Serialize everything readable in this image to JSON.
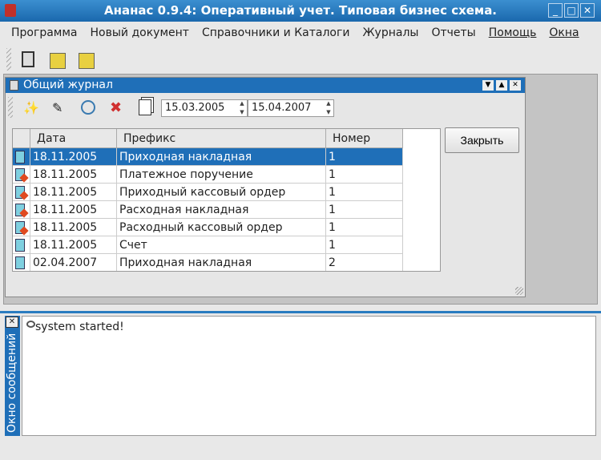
{
  "window": {
    "title": "Ананас 0.9.4: Оперативный учет. Типовая бизнес схема.",
    "minimize": "_",
    "maximize": "□",
    "close": "✕"
  },
  "menu": [
    {
      "label": "Программа"
    },
    {
      "label": "Новый документ"
    },
    {
      "label": "Справочники и Каталоги"
    },
    {
      "label": "Журналы"
    },
    {
      "label": "Отчеты"
    },
    {
      "label": "Помощь",
      "underline": true
    },
    {
      "label": "Окна",
      "underline": true
    }
  ],
  "journal": {
    "title": "Общий журнал",
    "controls": {
      "down": "▼",
      "up": "▲",
      "close": "✕"
    },
    "date_from": "15.03.2005",
    "date_to": "15.04.2007",
    "close_button": "Закрыть",
    "columns": [
      "Дата",
      "Префикс",
      "Номер"
    ],
    "rows": [
      {
        "date": "18.11.2005",
        "prefix": "Приходная накладная",
        "number": "1",
        "icon": "document",
        "selected": true
      },
      {
        "date": "18.11.2005",
        "prefix": "Платежное поручение",
        "number": "1",
        "icon": "document-edit"
      },
      {
        "date": "18.11.2005",
        "prefix": "Приходный кассовый ордер",
        "number": "1",
        "icon": "document-edit"
      },
      {
        "date": "18.11.2005",
        "prefix": "Расходная накладная",
        "number": "1",
        "icon": "document-edit"
      },
      {
        "date": "18.11.2005",
        "prefix": "Расходный кассовый ордер",
        "number": "1",
        "icon": "document-edit"
      },
      {
        "date": "18.11.2005",
        "prefix": "Счет",
        "number": "1",
        "icon": "document"
      },
      {
        "date": "02.04.2007",
        "prefix": "Приходная накладная",
        "number": "2",
        "icon": "document"
      }
    ]
  },
  "messages": {
    "title": "Окно сообщений",
    "close": "✕",
    "lines": [
      "system started!"
    ]
  },
  "colors": {
    "accent": "#1f6fb8",
    "titlebar": "#1a68ad"
  }
}
